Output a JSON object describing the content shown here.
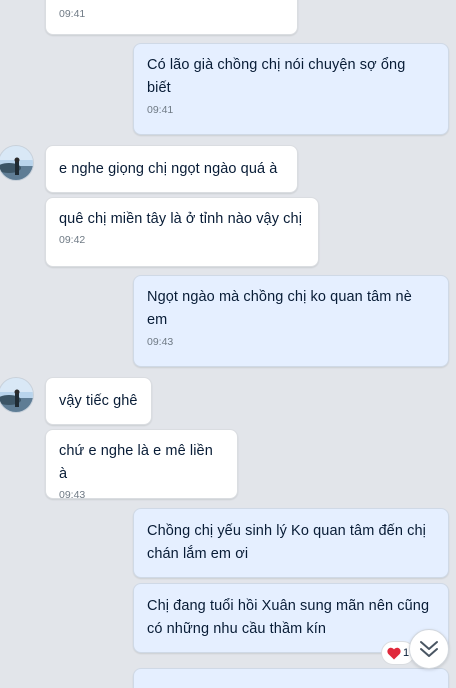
{
  "messages": [
    {
      "dir": "in",
      "text": "",
      "time": "09:41"
    },
    {
      "dir": "out",
      "text": "Có lão già chồng chị nói chuyện sợ ổng biết",
      "time": "09:41"
    },
    {
      "dir": "in",
      "text": "e nghe giọng chị ngọt ngào quá à",
      "time": ""
    },
    {
      "dir": "in",
      "text": "quê chị miền tây là ở tỉnh nào vậy chị",
      "time": "09:42"
    },
    {
      "dir": "out",
      "text": "Ngọt ngào mà chồng chị ko quan tâm nè em",
      "time": "09:43"
    },
    {
      "dir": "in",
      "text": "vậy tiếc ghê",
      "time": ""
    },
    {
      "dir": "in",
      "text": "chứ e nghe là e mê liền à",
      "time": "09:43"
    },
    {
      "dir": "out",
      "text": "Chồng chị yếu sinh lý Ko quan tâm đến chị chán lắm em ơi",
      "time": ""
    },
    {
      "dir": "out",
      "text": "Chị đang tuổi hồi Xuân sung mãn nên cũng có những nhu cầu thầm kín",
      "time": ""
    }
  ],
  "reaction": {
    "icon": "heart-icon",
    "count": "1"
  },
  "colors": {
    "incoming": "#ffffff",
    "outgoing": "#e5efff",
    "heart": "#e0283b"
  }
}
